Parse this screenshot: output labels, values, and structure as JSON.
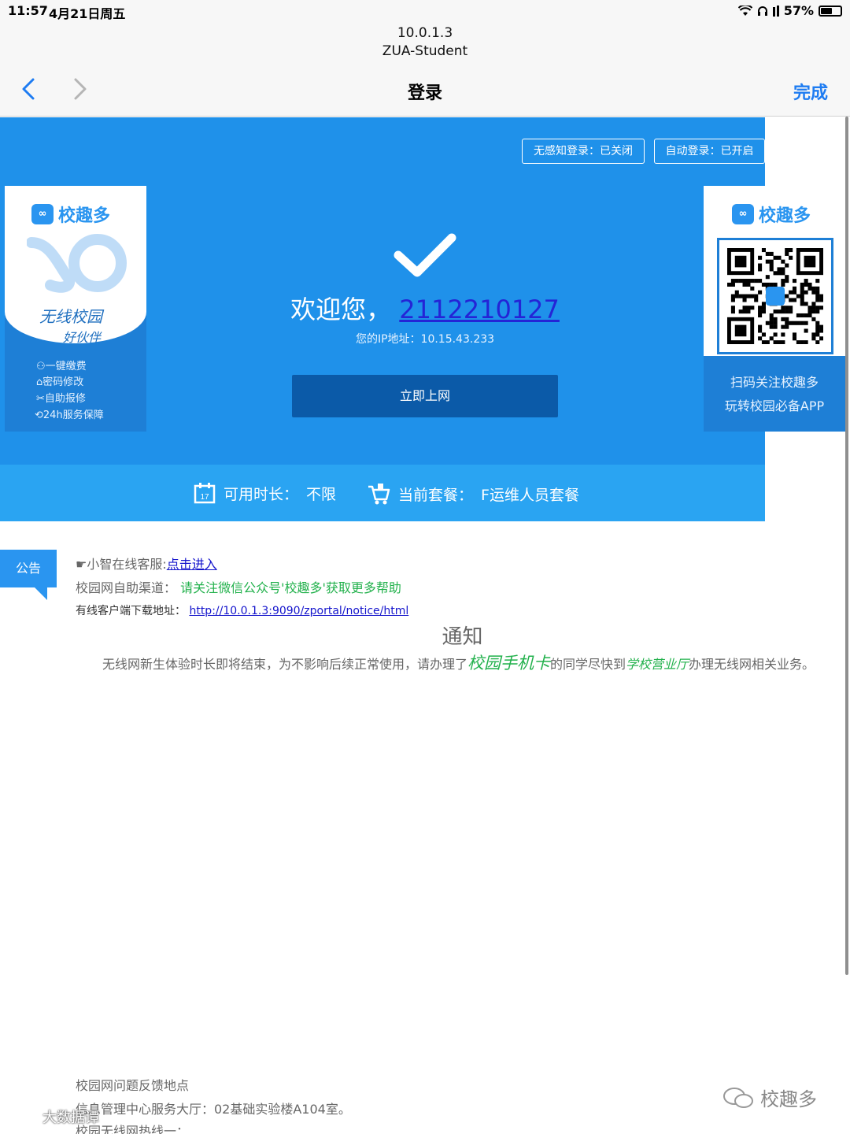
{
  "status_bar": {
    "time": "11:57",
    "date": "4月21日周五",
    "battery": "57%",
    "battery_level": 0.57,
    "icons": [
      "wifi-icon",
      "headphones-icon",
      "signal-icon",
      "battery-icon"
    ]
  },
  "nav": {
    "host": "10.0.1.3",
    "network": "ZUA-Student",
    "title": "登录",
    "done": "完成"
  },
  "toggles": {
    "senseless": "无感知登录：已关闭",
    "auto": "自动登录：已开启"
  },
  "ad_left": {
    "brand": "校趣多",
    "slogan": "无线校园",
    "slogan2": "好伙伴",
    "features": [
      "一键缴费",
      "密码修改",
      "自助报修",
      "24h服务保障"
    ]
  },
  "ad_right": {
    "brand": "校趣多",
    "caption1": "扫码关注校趣多",
    "caption2": "玩转校园必备APP"
  },
  "welcome": {
    "prefix": "欢迎您，",
    "user": "2112210127",
    "ip_label": "您的IP地址：",
    "ip": "10.15.43.233",
    "button": "立即上网"
  },
  "info": {
    "duration_label": "可用时长：",
    "duration": "不限",
    "package_label": "当前套餐：",
    "package": "F运维人员套餐",
    "calendar_day": "17"
  },
  "notice": {
    "badge": "公告",
    "service_label": "☛小智在线客服:",
    "service_link": "点击进入",
    "self_label": "校园网自助渠道：",
    "self_text": "请关注微信公众号'校趣多'获取更多帮助",
    "download_label": "有线客户端下载地址：",
    "download_url": "http://10.0.1.3:9090/zportal/notice/html",
    "title": "通知",
    "body_1": "无线网新生体验时长即将结束，为不影响后续正常使用，请办理了",
    "body_em1": "校园手机卡",
    "body_2": "的同学尽快到",
    "body_em2": "学校营业厅",
    "body_3": "办理无线网相关业务。"
  },
  "footer": {
    "line1": "校园网问题反馈地点",
    "line2": "信息管理中心服务大厅：02基础实验楼A104室。",
    "line3": "校园无线网热线一："
  },
  "watermarks": {
    "right": "校趣多",
    "left": "大数据谭"
  }
}
